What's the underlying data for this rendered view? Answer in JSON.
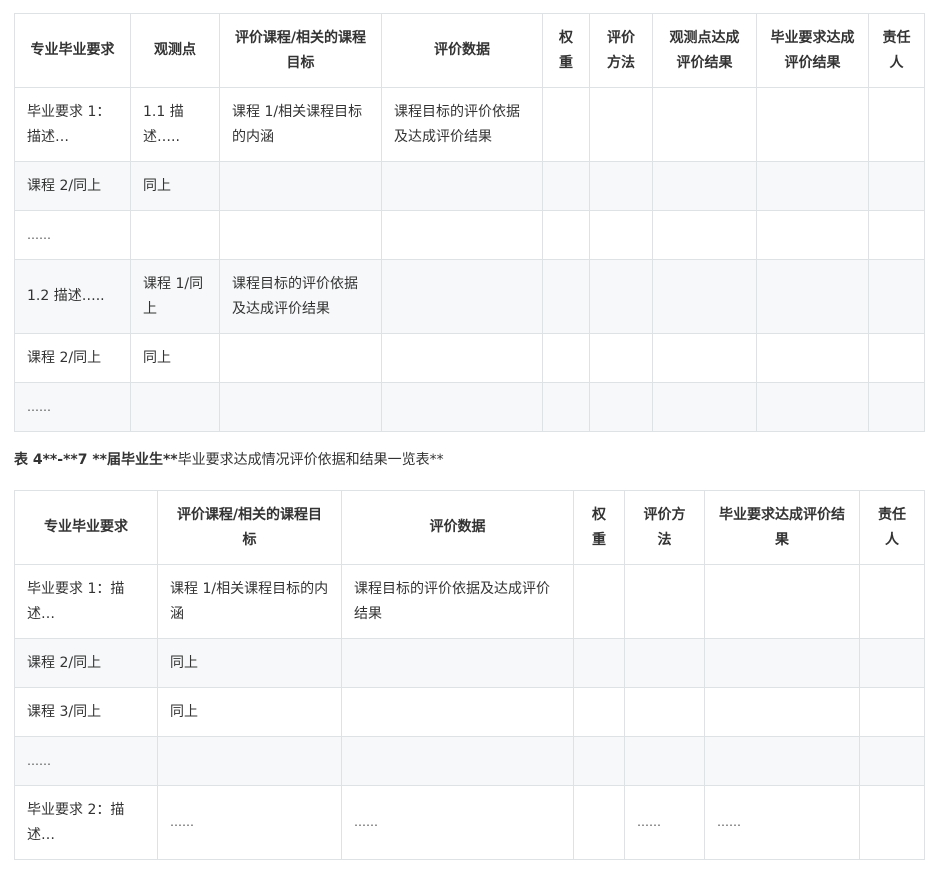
{
  "table1": {
    "headers": [
      "专业毕业要求",
      "观测点",
      "评价课程/相关的课程目标",
      "评价数据",
      "权重",
      "评价方法",
      "观测点达成评价结果",
      "毕业要求达成评价结果",
      "责任人"
    ],
    "rows": [
      [
        "毕业要求 1：描述…",
        "1.1 描述…..",
        "课程 1/相关课程目标的内涵",
        "课程目标的评价依据及达成评价结果",
        "",
        "",
        "",
        "",
        ""
      ],
      [
        "课程 2/同上",
        "同上",
        "",
        "",
        "",
        "",
        "",
        "",
        ""
      ],
      [
        "……",
        "",
        "",
        "",
        "",
        "",
        "",
        "",
        ""
      ],
      [
        "1.2 描述…..",
        "课程 1/同上",
        "课程目标的评价依据及达成评价结果",
        "",
        "",
        "",
        "",
        "",
        ""
      ],
      [
        "课程 2/同上",
        "同上",
        "",
        "",
        "",
        "",
        "",
        "",
        ""
      ],
      [
        "……",
        "",
        "",
        "",
        "",
        "",
        "",
        "",
        ""
      ]
    ]
  },
  "caption": {
    "bold1": "表 4**-**7 **届毕业生**",
    "rest": "毕业要求达成情况评价依据和结果一览表**"
  },
  "table2": {
    "headers": [
      "专业毕业要求",
      "评价课程/相关的课程目标",
      "评价数据",
      "权重",
      "评价方法",
      "毕业要求达成评价结果",
      "责任人"
    ],
    "rows": [
      [
        "毕业要求 1：描述…",
        "课程 1/相关课程目标的内涵",
        "课程目标的评价依据及达成评价结果",
        "",
        "",
        "",
        ""
      ],
      [
        "课程 2/同上",
        "同上",
        "",
        "",
        "",
        "",
        ""
      ],
      [
        "课程 3/同上",
        "同上",
        "",
        "",
        "",
        "",
        ""
      ],
      [
        "……",
        "",
        "",
        "",
        "",
        "",
        ""
      ],
      [
        "毕业要求 2：描述…",
        "……",
        "……",
        "",
        "……",
        "……",
        ""
      ]
    ]
  }
}
